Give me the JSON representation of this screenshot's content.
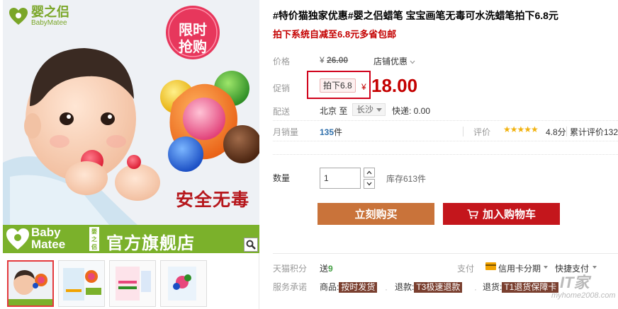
{
  "brand": {
    "name_zh": "婴之侣",
    "name_en": "BabyMatee"
  },
  "gallery": {
    "badge_line1": "限时",
    "badge_line2": "抢购",
    "safe_text": "安全无毒",
    "banner_en_line1": "Baby",
    "banner_en_line2": "Matee",
    "banner_vertical": "婴之侣",
    "banner_shop": "官方旗舰店",
    "thumbnails": [
      "thumb-1",
      "thumb-2",
      "thumb-3",
      "thumb-4"
    ],
    "active_thumbnail": 0
  },
  "product": {
    "title": "#特价猫独家优惠#婴之侣蜡笔 宝宝画笔无毒可水洗蜡笔拍下6.8元",
    "subtitle": "拍下系统自减至6.8元多省包邮"
  },
  "price": {
    "label": "价格",
    "currency": "¥",
    "original": "26.00",
    "shop_discount": "店铺优惠",
    "promo_label": "促销",
    "promo_tag": "拍下6.8",
    "promo_price": "18.00"
  },
  "shipping": {
    "label": "配送",
    "from": "北京 至",
    "to": "长沙",
    "express": "快递: 0.00"
  },
  "stats": {
    "monthly_label": "月销量",
    "monthly_count": "135",
    "monthly_unit": "件",
    "rating_label": "评价",
    "stars": "★★★★★",
    "rating_score": 4.8,
    "rating_text": "4.8分",
    "review_count": "累计评价132"
  },
  "quantity": {
    "label": "数量",
    "value": "1",
    "stock": "库存613件"
  },
  "actions": {
    "buy_now": "立刻购买",
    "add_to_cart": "加入购物车"
  },
  "meta": {
    "points_label": "天猫积分",
    "points_prefix": "送",
    "points_value": "9",
    "pay_label": "支付",
    "credit_option": "信用卡分期",
    "quick_pay": "快捷支付",
    "service_label": "服务承诺",
    "services": [
      {
        "prefix": "商品:",
        "tag": "按时发货"
      },
      {
        "prefix": "退款:",
        "tag": "T3极速退款"
      },
      {
        "prefix": "退货:",
        "tag": "T1退货保障卡"
      }
    ]
  },
  "watermark": {
    "line1": "IT家",
    "line2": "myhome2008.com"
  },
  "colors": {
    "brand_green": "#7bb12b",
    "price_red": "#c40000",
    "buy_now_bg": "#c9733a",
    "add_cart_bg": "#c4161c",
    "highlight_red": "#d0021b"
  }
}
